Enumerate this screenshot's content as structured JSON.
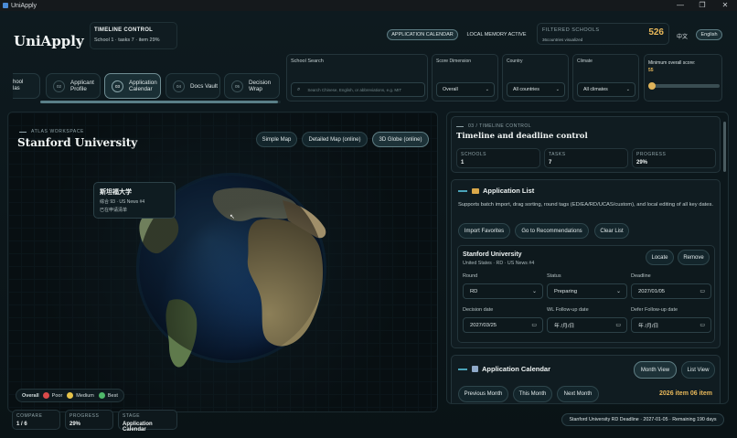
{
  "window": {
    "title": "UniApply",
    "minimize": "—",
    "maximize": "❐",
    "close": "✕"
  },
  "app": {
    "logo": "UniApply"
  },
  "timeline_control": {
    "label": "TIMELINE CONTROL",
    "detail": "School 1 · tasks 7 · item 29%"
  },
  "header_pills": {
    "calendar": "APPLICATION CALENDAR",
    "memory": "LOCAL MEMORY ACTIVE"
  },
  "filtered": {
    "label": "FILTERED SCHOOLS",
    "count": "526",
    "sub": "36countries visualized"
  },
  "lang": {
    "zh": "中文",
    "en": "English"
  },
  "steps": [
    {
      "num": "",
      "label": "hool\nlas"
    },
    {
      "num": "02",
      "label": "Applicant\nProfile"
    },
    {
      "num": "03",
      "label": "Application\nCalendar"
    },
    {
      "num": "04",
      "label": "Docs Vault"
    },
    {
      "num": "05",
      "label": "Decision\nWrap"
    }
  ],
  "progress_fraction": 0.99,
  "search": {
    "label": "School Search",
    "placeholder": "Search Chinese, English, or abbreviations, e.g. MIT"
  },
  "filters": {
    "score": {
      "label": "Score Dimension",
      "value": "Overall"
    },
    "country": {
      "label": "Country",
      "value": "All countries"
    },
    "climate": {
      "label": "Climate",
      "value": "All climates"
    },
    "min_score": {
      "label": "Minimum overall score:",
      "value": "55",
      "fraction": 0.0
    }
  },
  "atlas": {
    "eyebrow": "ATLAS WORKSPACE",
    "school": "Stanford University"
  },
  "map_modes": {
    "simple": "Simple Map",
    "detailed": "Detailed Map (online)",
    "globe": "3D Globe (online)"
  },
  "tooltip": {
    "name": "斯坦福大学",
    "rank": "综合 93 · US News #4",
    "status": "已在申请清单"
  },
  "legend": {
    "title": "Overall",
    "poor": "Poor",
    "medium": "Medium",
    "best": "Best",
    "poor_color": "#d94a4a",
    "medium_color": "#e6c34a",
    "best_color": "#4fb86a"
  },
  "panel": {
    "eyebrow": "03 / TIMELINE CONTROL",
    "title": "Timeline and deadline control",
    "stats": [
      {
        "label": "SCHOOLS",
        "value": "1"
      },
      {
        "label": "TASKS",
        "value": "7"
      },
      {
        "label": "PROGRESS",
        "value": "29%"
      }
    ]
  },
  "app_list": {
    "title": "Application List",
    "desc": "Supports batch import, drag sorting, round tags (ED/EA/RD/UCAS/custom), and local editing of all key dates.",
    "import": "Import Favorites",
    "recs": "Go to Recommendations",
    "clear": "Clear List"
  },
  "school_card": {
    "name": "Stanford University",
    "meta": "United States · RD · US News #4",
    "locate": "Locate",
    "remove": "Remove",
    "round_label": "Round",
    "round": "RD",
    "status_label": "Status",
    "status": "Preparing",
    "deadline_label": "Deadline",
    "deadline": "2027/01/05",
    "decision_label": "Decision date",
    "decision": "2027/03/25",
    "wl_label": "WL Follow-up date",
    "wl": "年 /月/日",
    "defer_label": "Defer Follow-up date",
    "defer": "年 /月/日"
  },
  "calendar": {
    "title": "Application Calendar",
    "month_view": "Month View",
    "list_view": "List View",
    "prev": "Previous Month",
    "this": "This Month",
    "next": "Next Month",
    "period": "2026 item 06 item"
  },
  "footer": {
    "compare_label": "COMPARE",
    "compare": "1 / 6",
    "progress_label": "PROGRESS",
    "progress": "29%",
    "stage_label": "STAGE",
    "stage": "Application Calendar",
    "status": "Stanford University RD Deadline · 2027-01-05 · Remaining 190 days"
  }
}
